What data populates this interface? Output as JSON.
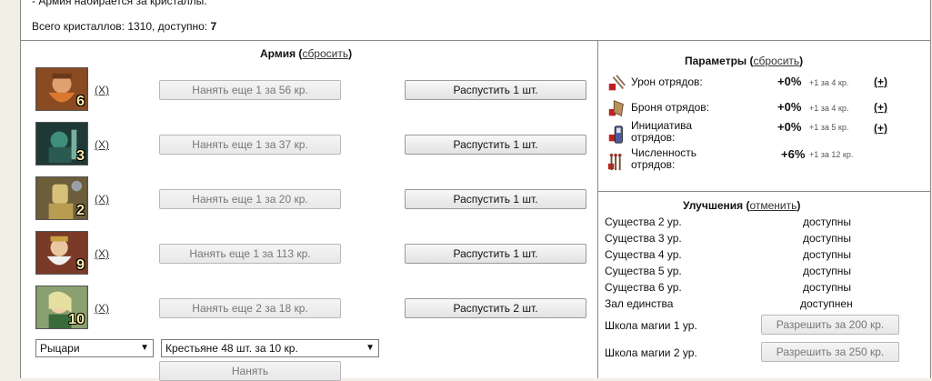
{
  "top_note": "- Армия набирается за кристаллы.",
  "crystals": {
    "label": "Всего кристаллов: 1310, доступно: ",
    "available": "7"
  },
  "army": {
    "title": "Армия",
    "reset": "сбросить",
    "units": [
      {
        "count": "6",
        "remove": "(X)",
        "hire": "Нанять еще 1 за 56 кр.",
        "dismiss": "Распустить 1 шт.",
        "icon": "dwarf-warrior-portrait",
        "color": "#c46a2a"
      },
      {
        "count": "3",
        "remove": "(X)",
        "hire": "Нанять еще 1 за 37 кр.",
        "dismiss": "Распустить 1 шт.",
        "icon": "undead-knight-portrait",
        "color": "#2e6e5e"
      },
      {
        "count": "2",
        "remove": "(X)",
        "hire": "Нанять еще 1 за 20 кр.",
        "dismiss": "Распустить 1 шт.",
        "icon": "paladin-portrait",
        "color": "#b9a060"
      },
      {
        "count": "9",
        "remove": "(X)",
        "hire": "Нанять еще 1 за 113 кр.",
        "dismiss": "Распустить 1 шт.",
        "icon": "priest-portrait",
        "color": "#c8563a"
      },
      {
        "count": "10",
        "remove": "(X)",
        "hire": "Нанять еще 2 за 18 кр.",
        "dismiss": "Распустить 2 шт.",
        "icon": "elf-archer-portrait",
        "color": "#7fa868"
      }
    ],
    "faction_select": "Рыцари",
    "unit_select": "Крестьяне 48 шт. за 10 кр.",
    "hire_button": "Нанять"
  },
  "params": {
    "title": "Параметры",
    "reset": "сбросить",
    "rows": [
      {
        "label": "Урон отрядов:",
        "value": "+0%",
        "cost": "+1 за 4 кр.",
        "plus": "(+)",
        "icon": "damage-icon"
      },
      {
        "label": "Броня отрядов:",
        "value": "+0%",
        "cost": "+1 за 4 кр.",
        "plus": "(+)",
        "icon": "armor-icon"
      },
      {
        "label": "Инициатива отрядов:",
        "value": "+0%",
        "cost": "+1 за 5 кр.",
        "plus": "(+)",
        "icon": "initiative-icon"
      },
      {
        "label": "Численность отрядов:",
        "value": "+6%",
        "cost": "+1 за 12 кр.",
        "plus": "",
        "icon": "headcount-icon"
      }
    ]
  },
  "upgrades": {
    "title": "Улучшения",
    "cancel": "отменить",
    "rows": [
      {
        "name": "Существа 2 ур.",
        "status": "доступны"
      },
      {
        "name": "Существа 3 ур.",
        "status": "доступны"
      },
      {
        "name": "Существа 4 ур.",
        "status": "доступны"
      },
      {
        "name": "Существа 5 ур.",
        "status": "доступны"
      },
      {
        "name": "Существа 6 ур.",
        "status": "доступны"
      },
      {
        "name": "Зал единства",
        "status": "доступнен"
      }
    ],
    "magic": [
      {
        "name": "Школа магии 1 ур.",
        "button": "Разрешить за 200 кр."
      },
      {
        "name": "Школа магии 2 ур.",
        "button": "Разрешить за 250 кр."
      }
    ]
  }
}
